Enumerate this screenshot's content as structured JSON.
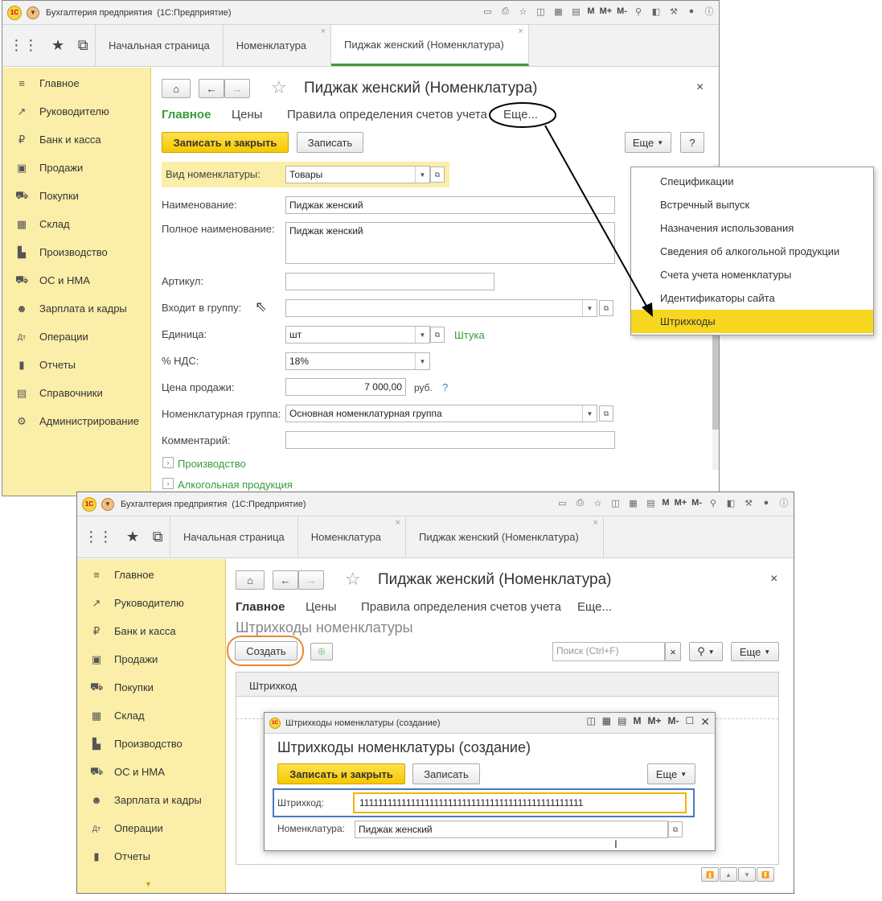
{
  "app_title": "Бухгалтерия предприятия",
  "app_platform": "(1С:Предприятие)",
  "logo_text": "1С",
  "toolbar_letters": [
    "M",
    "M+",
    "M-"
  ],
  "tabs": [
    {
      "label": "Начальная страница"
    },
    {
      "label": "Номенклатура"
    },
    {
      "label": "Пиджак женский (Номенклатура)"
    }
  ],
  "sidebar": [
    {
      "label": "Главное",
      "icon": "menu-icon"
    },
    {
      "label": "Руководителю",
      "icon": "chart-icon"
    },
    {
      "label": "Банк и касса",
      "icon": "ruble-icon"
    },
    {
      "label": "Продажи",
      "icon": "bag-icon"
    },
    {
      "label": "Покупки",
      "icon": "cart-icon"
    },
    {
      "label": "Склад",
      "icon": "warehouse-icon"
    },
    {
      "label": "Производство",
      "icon": "factory-icon"
    },
    {
      "label": "ОС и НМА",
      "icon": "truck-icon"
    },
    {
      "label": "Зарплата и кадры",
      "icon": "person-icon"
    },
    {
      "label": "Операции",
      "icon": "dt-kt-icon"
    },
    {
      "label": "Отчеты",
      "icon": "bars-icon"
    },
    {
      "label": "Справочники",
      "icon": "book-icon"
    },
    {
      "label": "Администрирование",
      "icon": "gear-icon"
    }
  ],
  "form": {
    "title": "Пиджак женский (Номенклатура)",
    "nav": [
      "Главное",
      "Цены",
      "Правила определения счетов учета",
      "Еще..."
    ],
    "save_close": "Записать и закрыть",
    "save": "Записать",
    "more": "Еще",
    "help": "?",
    "fields": {
      "kind_label": "Вид номенклатуры:",
      "kind_value": "Товары",
      "name_label": "Наименование:",
      "name_value": "Пиджак женский",
      "fullname_label": "Полное наименование:",
      "fullname_value": "Пиджак женский",
      "article_label": "Артикул:",
      "article_value": "",
      "group_label": "Входит в группу:",
      "group_value": "",
      "unit_label": "Единица:",
      "unit_value": "шт",
      "unit_hint": "Штука",
      "vat_label": "% НДС:",
      "vat_value": "18%",
      "price_label": "Цена продажи:",
      "price_value": "7 000,00",
      "price_currency": "руб.",
      "price_help": "?",
      "nomgroup_label": "Номенклатурная группа:",
      "nomgroup_value": "Основная номенклатурная группа",
      "comment_label": "Комментарий:",
      "comment_value": ""
    },
    "sections": [
      "Производство",
      "Алкогольная продукция"
    ]
  },
  "more_menu": [
    "Спецификации",
    "Встречный выпуск",
    "Назначения использования",
    "Сведения об алкогольной продукции",
    "Счета учета номенклатуры",
    "Идентификаторы сайта",
    "Штрихкоды"
  ],
  "second": {
    "sidebar": [
      {
        "label": "Главное",
        "icon": "menu-icon"
      },
      {
        "label": "Руководителю",
        "icon": "chart-icon"
      },
      {
        "label": "Банк и касса",
        "icon": "ruble-icon"
      },
      {
        "label": "Продажи",
        "icon": "bag-icon"
      },
      {
        "label": "Покупки",
        "icon": "cart-icon"
      },
      {
        "label": "Склад",
        "icon": "warehouse-icon"
      },
      {
        "label": "Производство",
        "icon": "factory-icon"
      },
      {
        "label": "ОС и НМА",
        "icon": "truck-icon"
      },
      {
        "label": "Зарплата и кадры",
        "icon": "person-icon"
      },
      {
        "label": "Операции",
        "icon": "dt-kt-icon"
      },
      {
        "label": "Отчеты",
        "icon": "bars-icon"
      }
    ],
    "subtitle": "Штрихкоды номенклатуры",
    "create": "Создать",
    "search_placeholder": "Поиск (Ctrl+F)",
    "search_clear": "×",
    "more": "Еще",
    "column_header": "Штрихкод"
  },
  "modal": {
    "window_title": "Штрихкоды номенклатуры (создание)",
    "title": "Штрихкоды номенклатуры (создание)",
    "save_close": "Записать и закрыть",
    "save": "Записать",
    "more": "Еще",
    "barcode_label": "Штрихкод:",
    "barcode_value": "111111111111111111111111111111111111111111111111",
    "nom_label": "Номенклатура:",
    "nom_value": "Пиджак женский"
  },
  "colors": {
    "accent_green": "#3a9a3a",
    "sidebar_bg": "#fbeea8",
    "highlight_yellow": "#f7d61f",
    "annotation_orange": "#e8882e",
    "annotation_blue": "#4a78c0"
  }
}
